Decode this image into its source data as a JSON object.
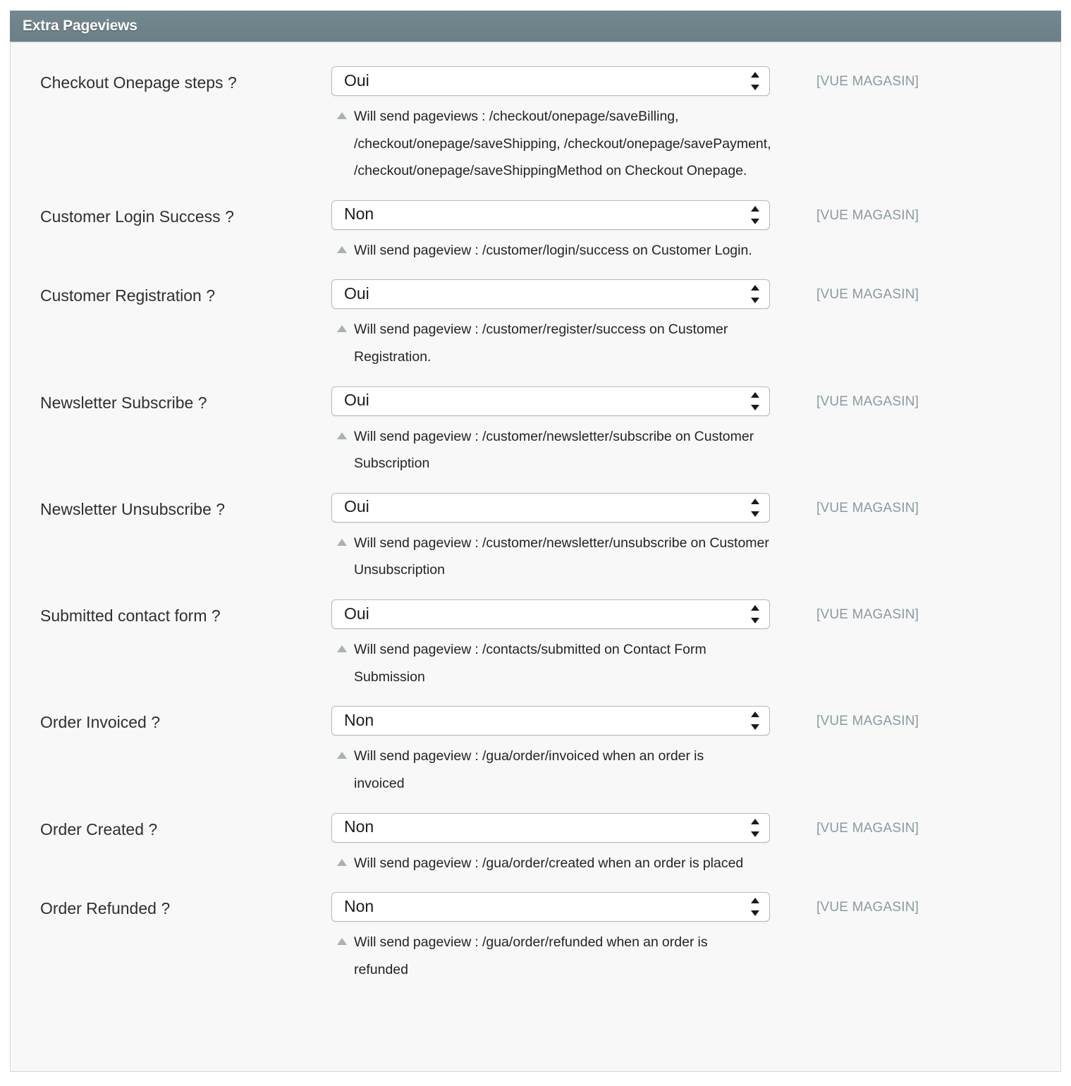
{
  "panel": {
    "title": "Extra Pageviews"
  },
  "icons": {
    "spinner": "updown-spinner-icon",
    "hint_bullet": "triangle-up-icon"
  },
  "colors": {
    "header_bg": "#6d8289",
    "panel_bg": "#f8f8f8",
    "panel_border": "#d6d6d6",
    "label_text": "#2f2f2f",
    "hint_text": "#242424",
    "scope_text": "#8b9aa1",
    "hint_bullet": "#a8b2b6",
    "select_border": "#b9b9b9"
  },
  "select_options": [
    "Oui",
    "Non"
  ],
  "rows": [
    {
      "label": "Checkout Onepage steps ?",
      "value": "Oui",
      "hint": "Will send pageviews : /checkout/onepage/saveBilling, /checkout/onepage/saveShipping, /checkout/onepage/savePayment, /checkout/onepage/saveShippingMethod on Checkout Onepage.",
      "scope": "[VUE MAGASIN]"
    },
    {
      "label": "Customer Login Success ?",
      "value": "Non",
      "hint": "Will send pageview : /customer/login/success on Customer Login.",
      "scope": "[VUE MAGASIN]"
    },
    {
      "label": "Customer Registration ?",
      "value": "Oui",
      "hint": "Will send pageview : /customer/register/success on Customer Registration.",
      "scope": "[VUE MAGASIN]"
    },
    {
      "label": "Newsletter Subscribe ?",
      "value": "Oui",
      "hint": "Will send pageview : /customer/newsletter/subscribe on Customer Subscription",
      "scope": "[VUE MAGASIN]"
    },
    {
      "label": "Newsletter Unsubscribe ?",
      "value": "Oui",
      "hint": "Will send pageview : /customer/newsletter/unsubscribe on Customer Unsubscription",
      "scope": "[VUE MAGASIN]"
    },
    {
      "label": "Submitted contact form ?",
      "value": "Oui",
      "hint": "Will send pageview : /contacts/submitted on Contact Form Submission",
      "scope": "[VUE MAGASIN]"
    },
    {
      "label": "Order Invoiced ?",
      "value": "Non",
      "hint": "Will send pageview : /gua/order/invoiced when an order is invoiced",
      "scope": "[VUE MAGASIN]"
    },
    {
      "label": "Order Created ?",
      "value": "Non",
      "hint": "Will send pageview : /gua/order/created when an order is placed",
      "scope": "[VUE MAGASIN]"
    },
    {
      "label": "Order Refunded ?",
      "value": "Non",
      "hint": "Will send pageview : /gua/order/refunded when an order is refunded",
      "scope": "[VUE MAGASIN]"
    }
  ]
}
